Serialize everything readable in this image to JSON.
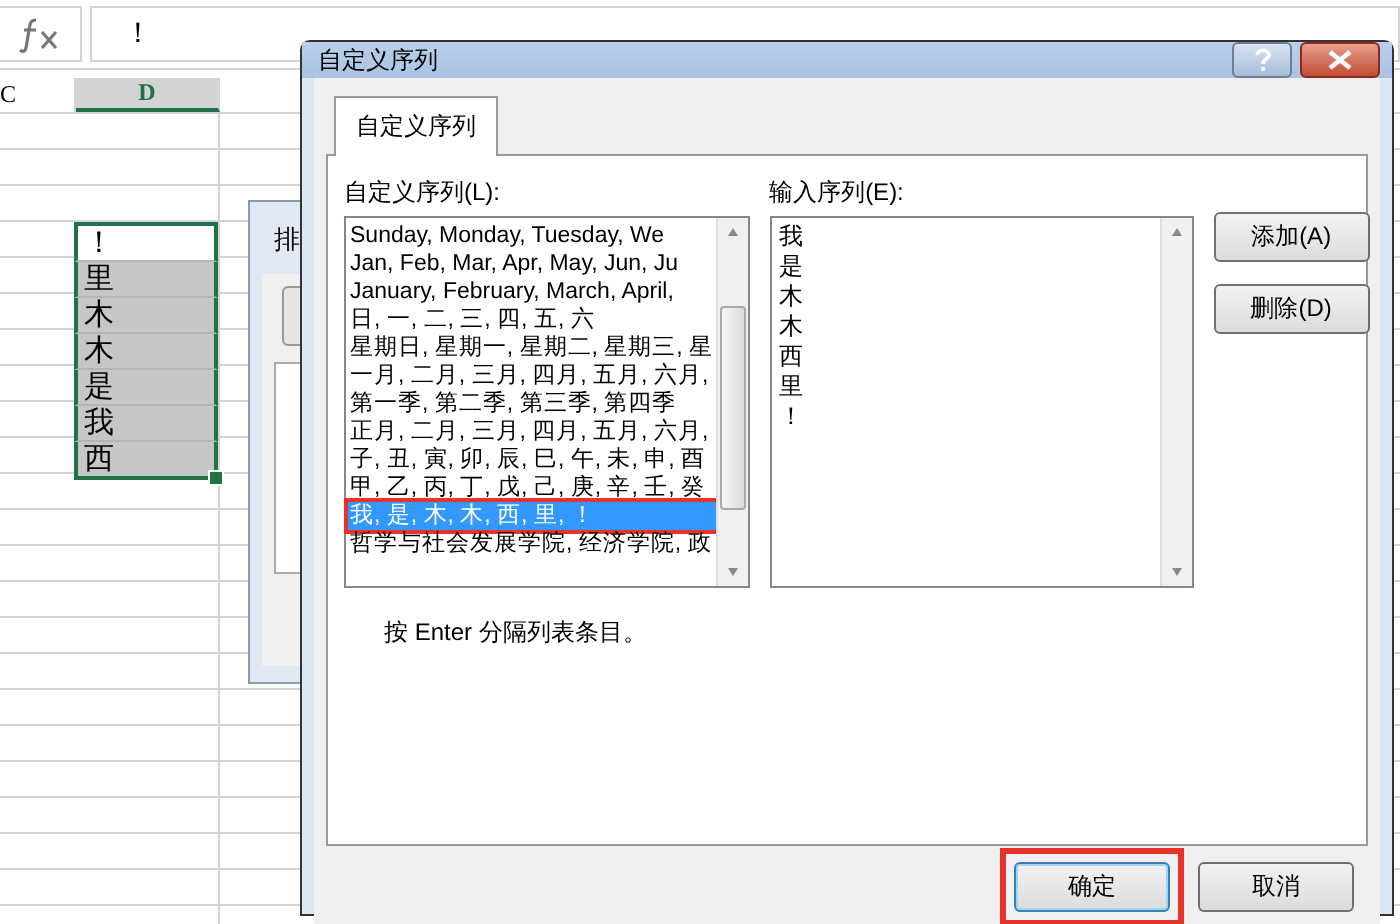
{
  "formula_bar": {
    "value": "！"
  },
  "sheet": {
    "columns": [
      {
        "label": "C",
        "selected": false
      },
      {
        "label": "D",
        "selected": true
      }
    ],
    "cells": [
      {
        "text": "！",
        "selected": false
      },
      {
        "text": "里",
        "selected": true
      },
      {
        "text": "木",
        "selected": true
      },
      {
        "text": "木",
        "selected": true
      },
      {
        "text": "是",
        "selected": true
      },
      {
        "text": "我",
        "selected": true
      },
      {
        "text": "西",
        "selected": true
      }
    ]
  },
  "back_dialog": {
    "title": "排"
  },
  "dialog": {
    "title": "自定义序列",
    "tabs": [
      {
        "label": "自定义序列",
        "selected": true
      }
    ],
    "list_label": "自定义序列(L):",
    "lists": [
      {
        "text": "Sunday, Monday, Tuesday, We",
        "selected": false,
        "highlighted": false
      },
      {
        "text": "Jan, Feb, Mar, Apr, May, Jun, Ju",
        "selected": false,
        "highlighted": false
      },
      {
        "text": "January, February, March, April,",
        "selected": false,
        "highlighted": false
      },
      {
        "text": "日, 一, 二, 三, 四, 五, 六",
        "selected": false,
        "highlighted": false
      },
      {
        "text": "星期日, 星期一, 星期二, 星期三, 星",
        "selected": false,
        "highlighted": false
      },
      {
        "text": "一月, 二月, 三月, 四月, 五月, 六月,",
        "selected": false,
        "highlighted": false
      },
      {
        "text": "第一季, 第二季, 第三季, 第四季",
        "selected": false,
        "highlighted": false
      },
      {
        "text": "正月, 二月, 三月, 四月, 五月, 六月,",
        "selected": false,
        "highlighted": false
      },
      {
        "text": "子, 丑, 寅, 卯, 辰, 巳, 午, 未, 申, 酉",
        "selected": false,
        "highlighted": false
      },
      {
        "text": "甲, 乙, 丙, 丁, 戊, 己, 庚, 辛, 壬, 癸",
        "selected": false,
        "highlighted": false
      },
      {
        "text": "我, 是, 木, 木, 西, 里, ！",
        "selected": true,
        "highlighted": true
      },
      {
        "text": "哲学与社会发展学院, 经济学院, 政",
        "selected": false,
        "highlighted": false
      }
    ],
    "entries_label": "输入序列(E):",
    "entries": [
      "我",
      "是",
      "木",
      "木",
      "西",
      "里",
      "！"
    ],
    "side_buttons": [
      "添加(A)",
      "删除(D)"
    ],
    "hint": "按 Enter 分隔列表条目。",
    "buttons": [
      {
        "label": "确定",
        "default": true,
        "highlighted": true
      },
      {
        "label": "取消",
        "default": false,
        "highlighted": false
      }
    ]
  }
}
